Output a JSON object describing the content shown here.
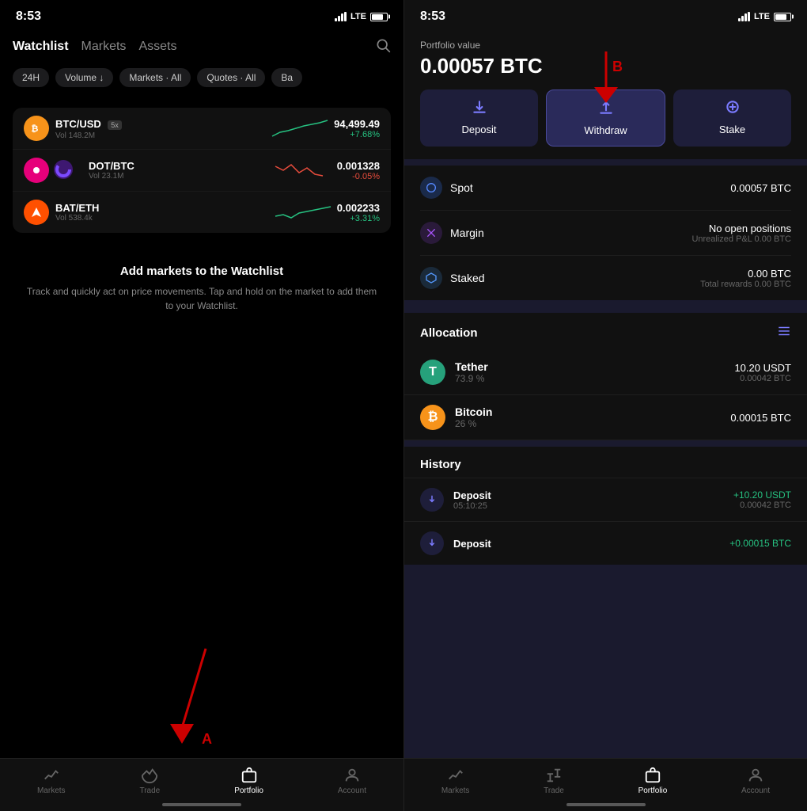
{
  "left_phone": {
    "status_time": "8:53",
    "lte": "LTE",
    "nav_tabs": [
      {
        "label": "Watchlist",
        "active": true
      },
      {
        "label": "Markets",
        "active": false
      },
      {
        "label": "Assets",
        "active": false
      }
    ],
    "filter_chips": [
      "24H",
      "Volume ↓",
      "Markets · All",
      "Quotes · All",
      "Ba"
    ],
    "market_rows": [
      {
        "pair": "BTC/USD",
        "badge": "5x",
        "vol": "Vol 148.2M",
        "price": "94,499.49",
        "change": "+7.68%",
        "positive": true,
        "color": "#f7931a"
      },
      {
        "pair": "DOT/BTC",
        "badge": "",
        "vol": "Vol 23.1M",
        "price": "0.001328",
        "change": "-0.05%",
        "positive": false,
        "color": "#e6007a"
      },
      {
        "pair": "BAT/ETH",
        "badge": "",
        "vol": "Vol 538.4k",
        "price": "0.002233",
        "change": "+3.31%",
        "positive": true,
        "color": "#ff5000"
      }
    ],
    "watchlist_empty_title": "Add markets to the Watchlist",
    "watchlist_empty_desc": "Track and quickly act on price movements. Tap and hold on the market to add them to your Watchlist.",
    "arrow_a_label": "A",
    "bottom_nav": [
      {
        "label": "Markets",
        "icon": "📈",
        "active": false
      },
      {
        "label": "Trade",
        "icon": "🔄",
        "active": false
      },
      {
        "label": "Portfolio",
        "icon": "📋",
        "active": true
      },
      {
        "label": "Account",
        "icon": "👤",
        "active": false
      }
    ]
  },
  "right_phone": {
    "status_time": "8:53",
    "lte": "LTE",
    "portfolio_label": "Portfolio value",
    "portfolio_value": "0.00057 BTC",
    "arrow_b_label": "B",
    "action_buttons": [
      {
        "label": "Deposit",
        "icon": "⬇",
        "active": false
      },
      {
        "label": "Withdraw",
        "icon": "⬆",
        "active": true
      },
      {
        "label": "Stake",
        "icon": "⬇",
        "active": false
      }
    ],
    "balance_rows": [
      {
        "icon": "🔵",
        "icon_bg": "#1a2a4a",
        "label": "Spot",
        "value": "0.00057 BTC",
        "sub": ""
      },
      {
        "icon": "✕",
        "icon_bg": "#2a1a3a",
        "label": "Margin",
        "value": "No open positions",
        "sub": "Unrealized P&L  0.00 BTC"
      },
      {
        "icon": "⬇",
        "icon_bg": "#1a2a3a",
        "label": "Staked",
        "value": "0.00 BTC",
        "sub": "Total rewards  0.00 BTC"
      }
    ],
    "allocation_title": "Allocation",
    "allocation_items": [
      {
        "name": "Tether",
        "pct": "73.9 %",
        "value": "10.20 USDT",
        "btc": "0.00042 BTC",
        "color": "#26a17b",
        "symbol": "T"
      },
      {
        "name": "Bitcoin",
        "pct": "26 %",
        "value": "0.00015 BTC",
        "btc": "",
        "color": "#f7931a",
        "symbol": "₿"
      }
    ],
    "history_title": "History",
    "history_items": [
      {
        "type": "Deposit",
        "time": "05:10:25",
        "value": "+10.20  USDT",
        "btc": "0.00042 BTC"
      },
      {
        "type": "Deposit",
        "time": "",
        "value": "+0.00015 BTC",
        "btc": ""
      }
    ],
    "bottom_nav": [
      {
        "label": "Markets",
        "active": false
      },
      {
        "label": "Trade",
        "active": false
      },
      {
        "label": "Portfolio",
        "active": true
      },
      {
        "label": "Account",
        "active": false
      }
    ]
  }
}
